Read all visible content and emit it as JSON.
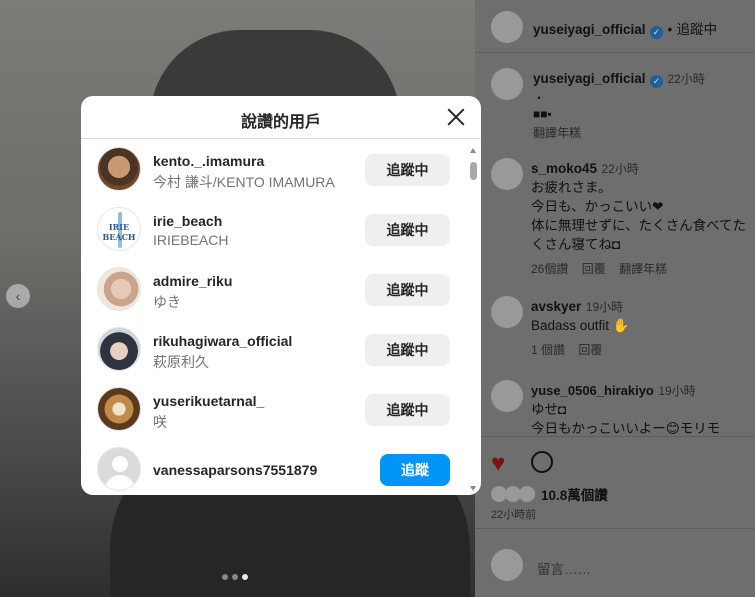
{
  "post": {
    "author": "yuseiyagi_official",
    "follow_status": "追蹤中",
    "caption_author": "yuseiyagi_official",
    "caption_time": "22小時",
    "caption_text": "・\n■■▪",
    "translate": "翻譯年糕",
    "likes": "10.8萬個讚",
    "posted": "22小時前",
    "comment_placeholder": "留言……"
  },
  "comments": [
    {
      "user": "s_moko45",
      "time": "22小時",
      "text": "お疲れさま。\n今日も、かっこいい❤\n体に無理せずに、たくさん食べてたくさん寝てね◘",
      "likes": "26個讚",
      "reply": "回覆",
      "translate": "翻譯年糕"
    },
    {
      "user": "avskyer",
      "time": "19小時",
      "text": "Badass outfit ✋",
      "likes": "1 個讚",
      "reply": "回覆"
    },
    {
      "user": "yuse_0506_hirakiyo",
      "time": "19小時",
      "text": "ゆせ◘\n今日もかっこいいよー😊モリモ"
    }
  ],
  "modal": {
    "title": "說讚的用戶",
    "users": [
      {
        "username": "kento._.imamura",
        "fullname": "今村 謙斗/KENTO IMAMURA",
        "button": "追蹤中",
        "avatar": "kento"
      },
      {
        "username": "irie_beach",
        "fullname": "IRIEBEACH",
        "button": "追蹤中",
        "avatar": "irie"
      },
      {
        "username": "admire_riku",
        "fullname": "ゆき",
        "button": "追蹤中",
        "avatar": "riku"
      },
      {
        "username": "rikuhagiwara_official",
        "fullname": "萩原利久",
        "button": "追蹤中",
        "avatar": "rikuh"
      },
      {
        "username": "yuserikuetarnal_",
        "fullname": "咲",
        "button": "追蹤中",
        "avatar": "yuse"
      },
      {
        "username": "vanessaparsons7551879",
        "fullname": "",
        "button": "追蹤",
        "avatar": "blank"
      }
    ],
    "irie_logo_text": "IRIE BEACH"
  },
  "colors": {
    "primary_button": "#0095f6",
    "secondary_button": "#efefef",
    "heart": "#ed4956"
  }
}
